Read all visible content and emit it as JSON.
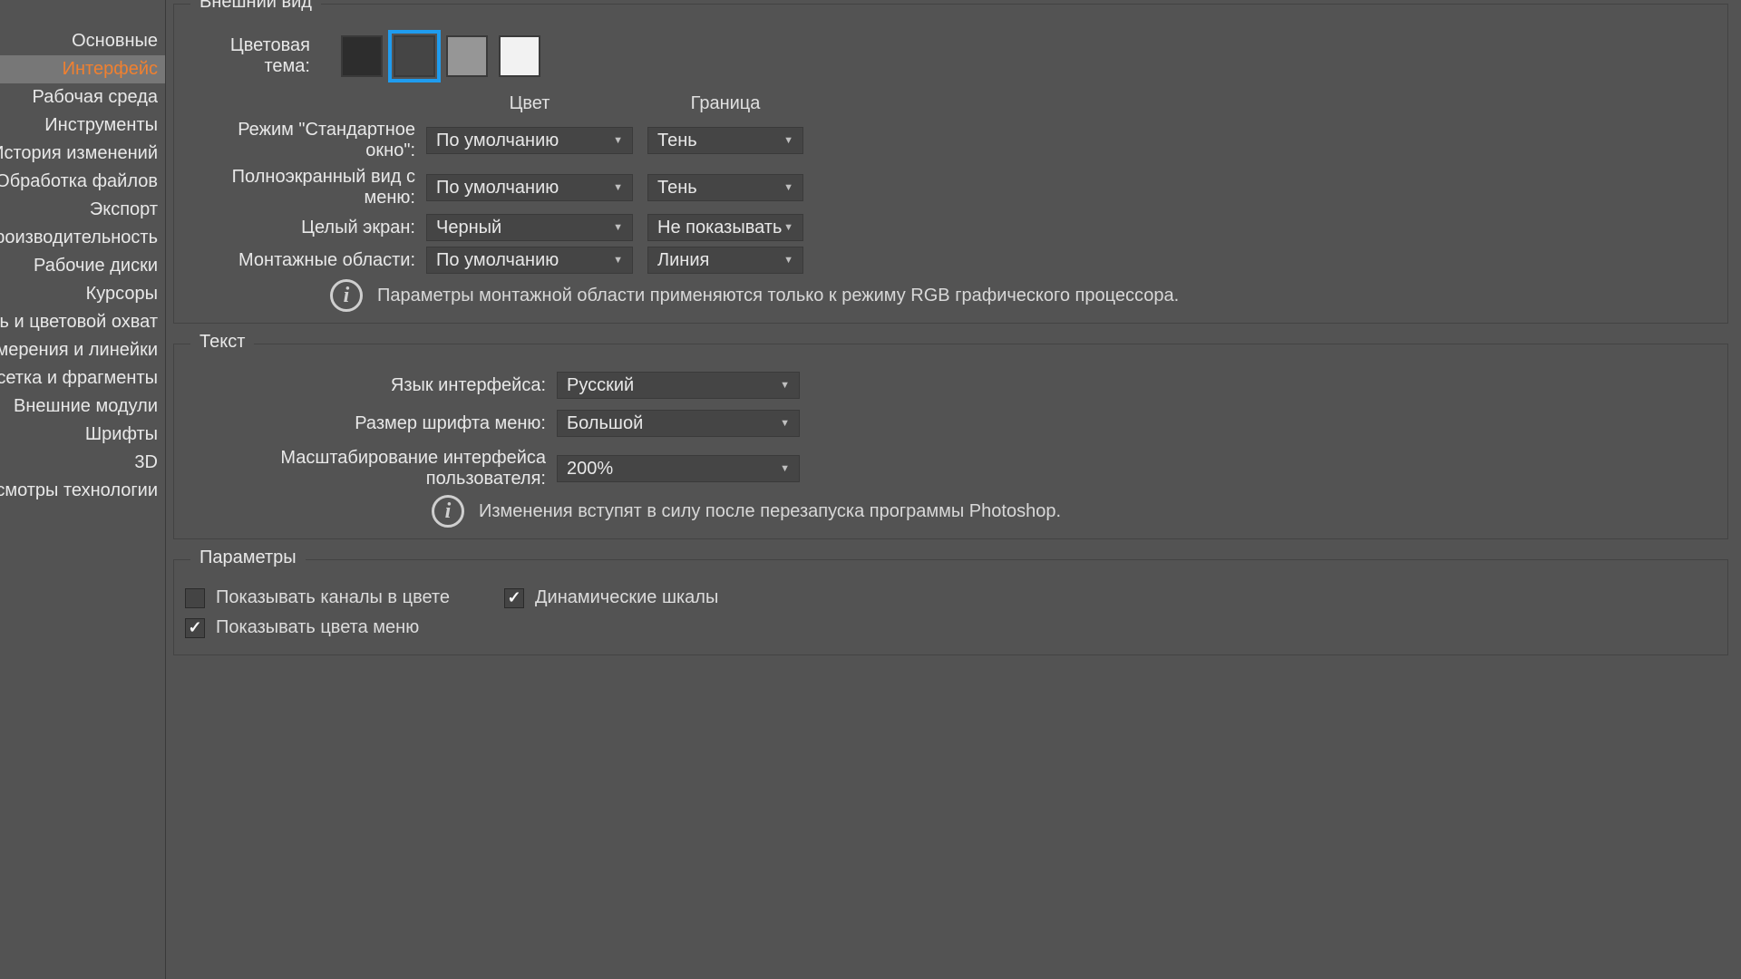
{
  "sidebar": {
    "items": [
      {
        "label": "Основные"
      },
      {
        "label": "Интерфейс",
        "selected": true,
        "highlighted": true
      },
      {
        "label": "Рабочая среда"
      },
      {
        "label": "Инструменты"
      },
      {
        "label": "История изменений"
      },
      {
        "label": "Обработка файлов"
      },
      {
        "label": "Экспорт"
      },
      {
        "label": "Производительность"
      },
      {
        "label": "Рабочие диски"
      },
      {
        "label": "Курсоры"
      },
      {
        "label": "Прозрачность и цветовой охват"
      },
      {
        "label": "Единицы измерения и линейки"
      },
      {
        "label": "Направляющие, сетка и фрагменты"
      },
      {
        "label": "Внешние модули"
      },
      {
        "label": "Шрифты"
      },
      {
        "label": "3D"
      },
      {
        "label": "Просмотры технологии"
      }
    ]
  },
  "appearance": {
    "title": "Внешний вид",
    "color_theme_label": "Цветовая тема:",
    "swatches": [
      "#2d2d2d",
      "#454545",
      "#969696",
      "#f2f2f2"
    ],
    "selected_swatch_index": 1,
    "headers": {
      "color": "Цвет",
      "border": "Граница"
    },
    "rows": [
      {
        "label": "Режим \"Стандартное окно\":",
        "color": "По умолчанию",
        "border": "Тень"
      },
      {
        "label": "Полноэкранный вид с меню:",
        "color": "По умолчанию",
        "border": "Тень"
      },
      {
        "label": "Целый экран:",
        "color": "Черный",
        "border": "Не показывать"
      },
      {
        "label": "Монтажные области:",
        "color": "По умолчанию",
        "border": "Линия"
      }
    ],
    "info": "Параметры монтажной области применяются только к режиму RGB графического процессора."
  },
  "text": {
    "title": "Текст",
    "language_label": "Язык интерфейса:",
    "language_value": "Русский",
    "fontsize_label": "Размер шрифта меню:",
    "fontsize_value": "Большой",
    "scaling_label": "Масштабирование интерфейса пользователя:",
    "scaling_value": "200%",
    "info": "Изменения вступят в силу после перезапуска программы Photoshop."
  },
  "params": {
    "title": "Параметры",
    "show_channels_color": {
      "label": "Показывать каналы в цвете",
      "checked": false
    },
    "dynamic_sliders": {
      "label": "Динамические шкалы",
      "checked": true
    },
    "show_menu_colors": {
      "label": "Показывать цвета меню",
      "checked": true
    }
  }
}
